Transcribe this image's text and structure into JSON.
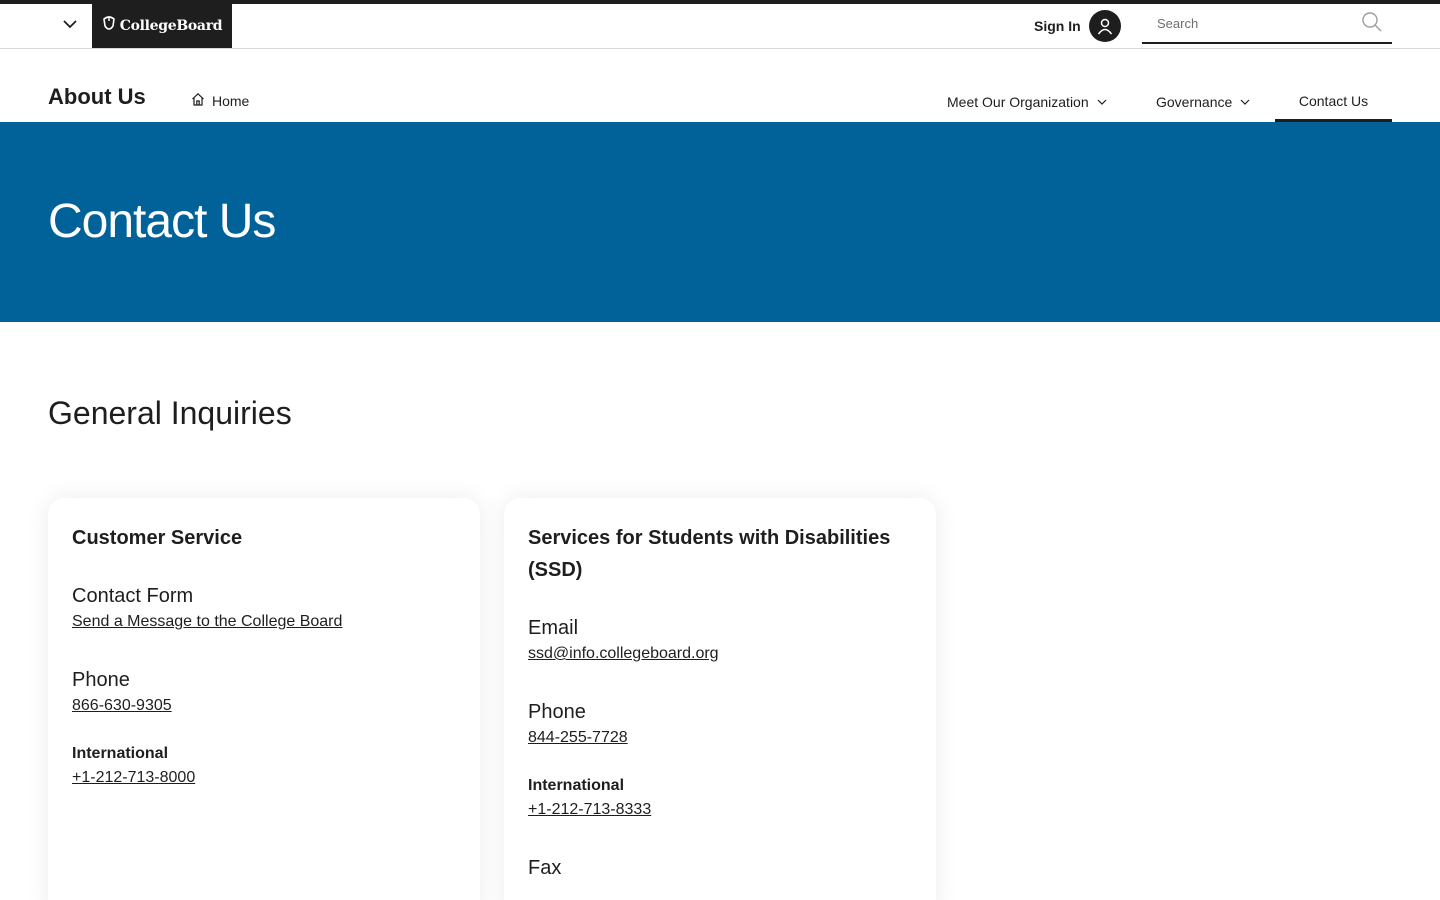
{
  "global_header": {
    "logo_text": "CollegeBoard",
    "sign_in_label": "Sign In",
    "search_placeholder": "Search",
    "icons": {
      "menu": "chevron-down-icon",
      "logo": "acorn-shield-icon",
      "account": "user-icon",
      "search": "search-icon"
    }
  },
  "local_nav": {
    "site_title": "About Us",
    "home_label": "Home",
    "items": [
      {
        "label": "Meet Our Organization",
        "has_dropdown": true
      },
      {
        "label": "Governance",
        "has_dropdown": true
      },
      {
        "label": "Contact Us",
        "active": true
      }
    ]
  },
  "hero": {
    "title": "Contact Us",
    "background_color": "#006299"
  },
  "main": {
    "section_heading": "General Inquiries",
    "cards": [
      {
        "title": "Customer Service",
        "contact_form_heading": "Contact Form",
        "contact_form_link": "Send a Message to the College Board",
        "phone_heading": "Phone",
        "phone": "866-630-9305",
        "intl_label": "International",
        "intl_phone": "+1-212-713-8000"
      },
      {
        "title": "Services for Students with Disabilities (SSD)",
        "email_heading": "Email",
        "email": "ssd@info.collegeboard.org",
        "phone_heading": "Phone",
        "phone": "844-255-7728",
        "intl_label": "International",
        "intl_phone": "+1-212-713-8333",
        "fax_heading": "Fax"
      }
    ]
  }
}
